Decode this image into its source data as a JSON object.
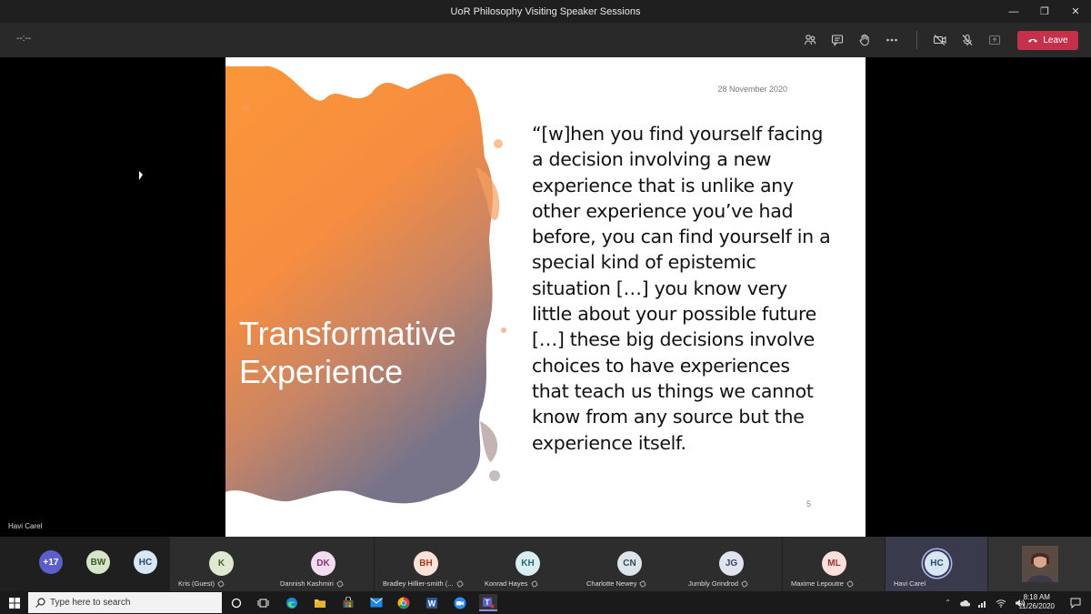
{
  "window": {
    "title": "UoR Philosophy Visiting Speaker Sessions",
    "controls": [
      "—",
      "❐",
      "✕"
    ]
  },
  "toolbar": {
    "timer": "--:--",
    "leave_label": "Leave",
    "leave_color": "#c4314b"
  },
  "slide": {
    "date": "28 November 2020",
    "title": "Transformative\nExperience",
    "quote": "“[w]hen you find yourself facing a decision involving a new experience that is unlike any other experience you’ve had before, you can find yourself in a special kind of epistemic situation […] you know very little about your possible future […] these big decisions involve choices to have experiences that teach us things we cannot know from any source but the experience itself.",
    "page_number": "5",
    "accent_color": "#f7923a"
  },
  "stage": {
    "speaker_name": "Havi Carel"
  },
  "participants": {
    "overflow": "+17",
    "group_avatars": [
      {
        "initials": "BW",
        "bg": "#d7e4c8",
        "fg": "#3c5a2a"
      },
      {
        "initials": "HC",
        "bg": "#d6e6f5",
        "fg": "#2a4a6a"
      }
    ],
    "tiles": [
      {
        "initials": "K",
        "name": "Kris (Guest)",
        "bg": "#dfe9cf",
        "fg": "#4a6130"
      },
      {
        "initials": "DK",
        "name": "Dannish Kashmiri",
        "bg": "#f3dcef",
        "fg": "#7a3a70"
      },
      {
        "initials": "BH",
        "name": "Bradley Hillier-smith (...",
        "bg": "#fde1d8",
        "fg": "#9a3c22"
      },
      {
        "initials": "KH",
        "name": "Konrad Hayes",
        "bg": "#d8eef3",
        "fg": "#2a6575"
      },
      {
        "initials": "CN",
        "name": "Charlotte Newey",
        "bg": "#dde5eb",
        "fg": "#34495a"
      },
      {
        "initials": "JG",
        "name": "Jumbly Grindrod",
        "bg": "#e0e4ee",
        "fg": "#3a4566"
      },
      {
        "initials": "ML",
        "name": "Maxime Lepoutre",
        "bg": "#fde0dc",
        "fg": "#9a3030"
      },
      {
        "initials": "HC",
        "name": "Havi Carel",
        "bg": "#d6e6f5",
        "fg": "#2a4a6a",
        "active": true
      }
    ]
  },
  "taskbar": {
    "search_placeholder": "Type here to search",
    "time": "8:18 AM",
    "date": "11/26/2020"
  }
}
